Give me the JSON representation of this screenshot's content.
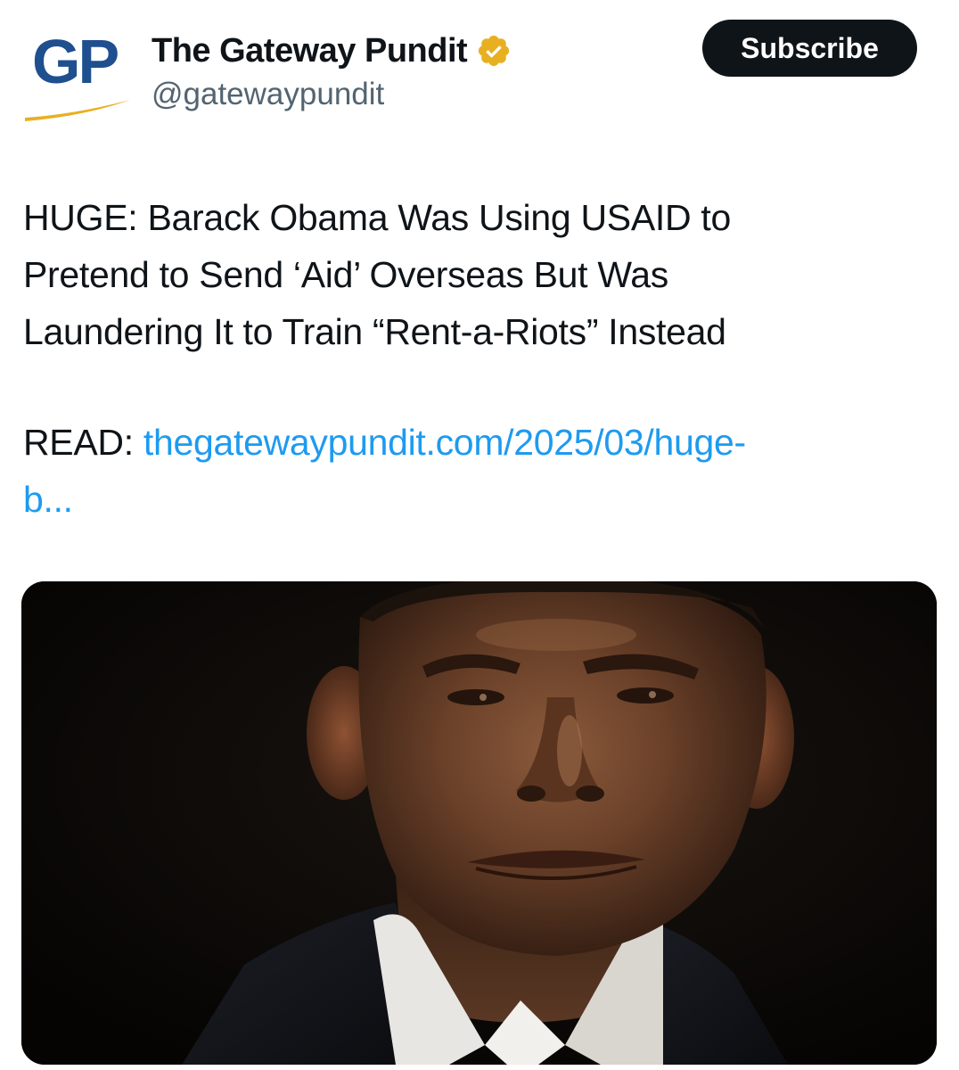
{
  "header": {
    "avatar_text": "GP",
    "display_name": "The Gateway Pundit",
    "handle": "@gatewaypundit",
    "subscribe_label": "Subscribe",
    "verified_badge": "verified-gold-badge-icon"
  },
  "post": {
    "text_lines": [
      "HUGE: Barack Obama Was Using USAID to",
      "Pretend to Send ‘Aid’ Overseas But Was",
      "Laundering It to Train “Rent-a-Riots” Instead"
    ],
    "read_label": "READ:",
    "link_text_line1": "thegatewaypundit.com/2025/03/huge-",
    "link_text_line2": "b..."
  },
  "colors": {
    "text": "#0f1419",
    "secondary_text": "#536471",
    "link": "#1d9bf0",
    "brand_blue": "#1f4f8f",
    "brand_gold": "#e8b021",
    "button_bg": "#0f1419",
    "button_text": "#ffffff"
  }
}
